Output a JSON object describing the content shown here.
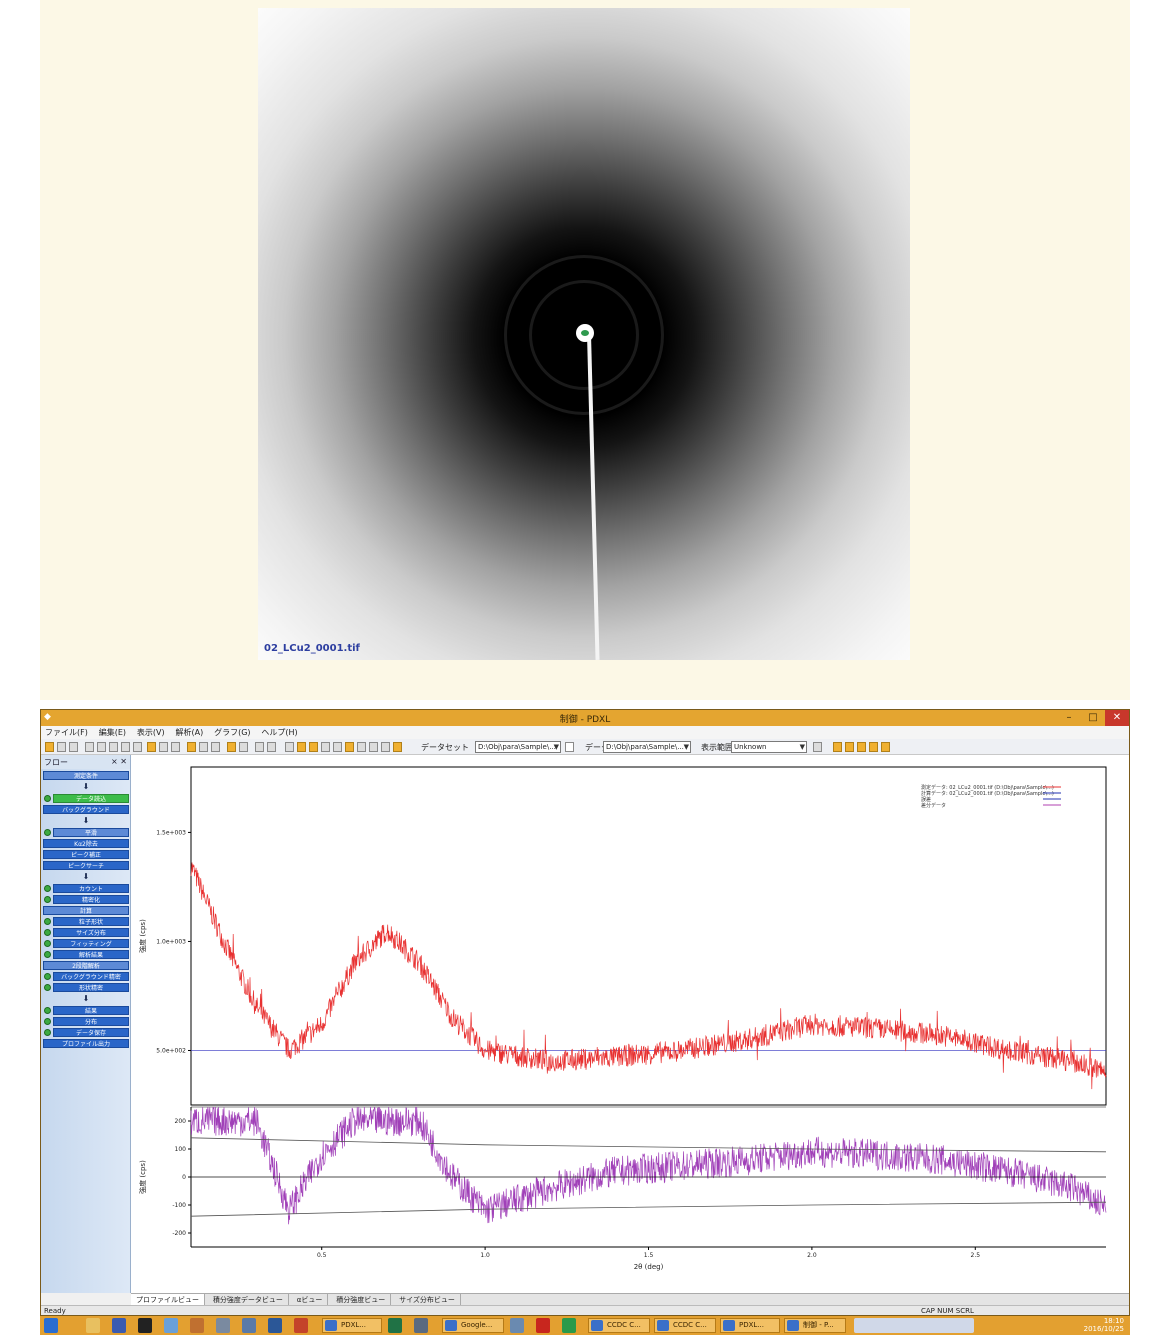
{
  "diffraction_image": {
    "filename": "02_LCu2_0001.tif"
  },
  "window": {
    "title": "制御 - PDXL",
    "minimize_glyph": "–",
    "maximize_glyph": "□",
    "close_glyph": "✕",
    "app_icon": "pdxl-icon"
  },
  "menu": [
    {
      "label": "ファイル(F)"
    },
    {
      "label": "編集(E)"
    },
    {
      "label": "表示(V)"
    },
    {
      "label": "解析(A)"
    },
    {
      "label": "グラフ(G)"
    },
    {
      "label": "ヘルプ(H)"
    }
  ],
  "toolbar": {
    "dataset_label": "データセット",
    "dataset_value": "D:\\Obj\\para\\Sample\\...",
    "data_label": "データ",
    "data_value": "D:\\Obj\\para\\Sample\\...",
    "display_label": "表示範囲",
    "display_value": "Unknown"
  },
  "left_panel": {
    "title": "フロー",
    "close_glyph": "× ✕",
    "arrow_glyph": "⬇",
    "items": [
      {
        "label": "測定条件",
        "style": "hdr"
      },
      {
        "label": "データ読込",
        "style": "green"
      },
      {
        "label": "バックグラウンド",
        "style": "item"
      },
      {
        "label": "平滑",
        "style": "hdr"
      },
      {
        "label": "Kα2除去",
        "style": "item"
      },
      {
        "label": "ピーク補正",
        "style": "item"
      },
      {
        "label": "ピークサーチ",
        "style": "item"
      },
      {
        "label": "カウント",
        "style": "item"
      },
      {
        "label": "精密化",
        "style": "item"
      },
      {
        "label": "計算",
        "style": "hdr"
      },
      {
        "label": "粒子形状",
        "style": "item"
      },
      {
        "label": "サイズ分布",
        "style": "item"
      },
      {
        "label": "フィッティング",
        "style": "item"
      },
      {
        "label": "解析結果",
        "style": "item"
      },
      {
        "label": "2段階解析",
        "style": "hdr"
      },
      {
        "label": "バックグラウンド精密",
        "style": "item"
      },
      {
        "label": "形状精密",
        "style": "item"
      },
      {
        "label": "結果",
        "style": "item"
      },
      {
        "label": "分布",
        "style": "item"
      },
      {
        "label": "データ保存",
        "style": "item"
      },
      {
        "label": "プロファイル出力",
        "style": "item"
      }
    ]
  },
  "chart_data": {
    "type": "line",
    "xlabel": "2θ (deg)",
    "x_ticks": [
      0.5,
      1.0,
      1.5,
      2.0,
      2.5
    ],
    "xlim": [
      0.1,
      2.9
    ],
    "upper": {
      "ylabel": "強度 (cps)",
      "y_ticks": [
        {
          "value": 1.5,
          "label": "1.5e+003"
        },
        {
          "value": 1.0,
          "label": "1.0e+003"
        },
        {
          "value": 0.5,
          "label": "5.0e+002"
        }
      ],
      "ylim": [
        0.25,
        1.8
      ],
      "baseline": 0.5,
      "legend": [
        {
          "name": "測定データ: 02_LCu2_0001.tif (D:\\Obj\\para\\Sample\\...)",
          "color": "#e83030"
        },
        {
          "name": "計算データ: 02_LCu2_0001.tif (D:\\Obj\\para\\Sample\\...)",
          "color": "#2030b0"
        },
        {
          "name": "誤差",
          "color": "#2030b0"
        },
        {
          "name": "差分データ",
          "color": "#b040b0"
        }
      ],
      "series": [
        {
          "name": "測定データ",
          "color": "#e83030",
          "points": [
            [
              0.1,
              1.35
            ],
            [
              0.2,
              1.0
            ],
            [
              0.3,
              0.7
            ],
            [
              0.4,
              0.5
            ],
            [
              0.5,
              0.62
            ],
            [
              0.6,
              0.9
            ],
            [
              0.7,
              1.05
            ],
            [
              0.8,
              0.9
            ],
            [
              0.9,
              0.65
            ],
            [
              1.0,
              0.5
            ],
            [
              1.2,
              0.45
            ],
            [
              1.4,
              0.47
            ],
            [
              1.6,
              0.5
            ],
            [
              1.8,
              0.55
            ],
            [
              2.0,
              0.62
            ],
            [
              2.2,
              0.6
            ],
            [
              2.4,
              0.57
            ],
            [
              2.6,
              0.5
            ],
            [
              2.8,
              0.45
            ],
            [
              2.9,
              0.4
            ]
          ],
          "noise": 0.05
        }
      ]
    },
    "lower": {
      "ylabel": "強度 (cps)",
      "y_ticks": [
        {
          "value": 200,
          "label": "200"
        },
        {
          "value": 100,
          "label": "100"
        },
        {
          "value": 0,
          "label": "0"
        },
        {
          "value": -100,
          "label": "-100"
        },
        {
          "value": -200,
          "label": "-200"
        }
      ],
      "ylim": [
        -250,
        250
      ],
      "series": [
        {
          "name": "差分データ",
          "color": "#a040b8",
          "points": [
            [
              0.1,
              200
            ],
            [
              0.3,
              200
            ],
            [
              0.4,
              -120
            ],
            [
              0.5,
              80
            ],
            [
              0.6,
              200
            ],
            [
              0.7,
              200
            ],
            [
              0.8,
              200
            ],
            [
              0.9,
              0
            ],
            [
              1.0,
              -120
            ],
            [
              1.2,
              -40
            ],
            [
              1.4,
              20
            ],
            [
              1.6,
              40
            ],
            [
              1.8,
              60
            ],
            [
              2.0,
              90
            ],
            [
              2.2,
              80
            ],
            [
              2.4,
              60
            ],
            [
              2.6,
              20
            ],
            [
              2.8,
              -40
            ],
            [
              2.9,
              -110
            ]
          ],
          "noise": 55
        },
        {
          "name": "誤差+",
          "color": "#555555",
          "points": [
            [
              0.1,
              140
            ],
            [
              1.0,
              115
            ],
            [
              2.0,
              100
            ],
            [
              2.9,
              90
            ]
          ]
        },
        {
          "name": "誤差-",
          "color": "#555555",
          "points": [
            [
              0.1,
              -140
            ],
            [
              1.0,
              -115
            ],
            [
              2.0,
              -100
            ],
            [
              2.9,
              -90
            ]
          ]
        }
      ]
    }
  },
  "tabs": [
    {
      "label": "プロファイルビュー",
      "active": true
    },
    {
      "label": "積分強度データビュー",
      "active": false
    },
    {
      "label": "αビュー",
      "active": false
    },
    {
      "label": "積分強度ビュー",
      "active": false
    },
    {
      "label": "サイズ分布ビュー",
      "active": false
    }
  ],
  "status": {
    "left": "Ready",
    "right": "CAP NUM SCRL"
  },
  "taskbar": {
    "tasks": [
      "PDXL...",
      "Google...",
      "Adobe...",
      "CCDC C...",
      "CCDC C...",
      "PDXL...",
      "制御 - P..."
    ],
    "time": "18:10",
    "date": "2016/10/25"
  },
  "colors": {
    "titlebar": "#e4a530",
    "measured": "#e83030",
    "difference": "#a040b8",
    "baseline": "#3030c0"
  }
}
